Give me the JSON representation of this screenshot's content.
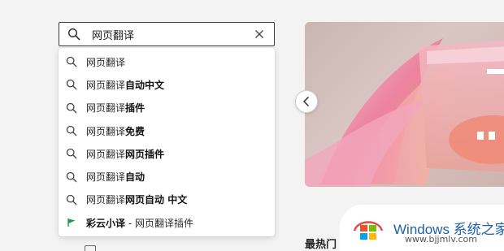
{
  "search": {
    "value": "网页翻译"
  },
  "suggestions": [
    {
      "base": "网页翻译",
      "extra": "",
      "icon": "search-icon"
    },
    {
      "base": "网页翻译",
      "extra": "自动中文",
      "icon": "search-icon"
    },
    {
      "base": "网页翻译",
      "extra": "插件",
      "icon": "search-icon"
    },
    {
      "base": "网页翻译",
      "extra": "免费",
      "icon": "search-icon"
    },
    {
      "base": "网页翻译",
      "extra": "网页插件",
      "icon": "search-icon"
    },
    {
      "base": "网页翻译",
      "extra": "自动",
      "icon": "search-icon"
    },
    {
      "base": "网页翻译",
      "extra": "网页自动 中文",
      "icon": "search-icon"
    }
  ],
  "app_suggestion": {
    "name": "彩云小译",
    "separator": " - ",
    "desc": "网页翻译插件",
    "icon": "caiyun-flag-icon",
    "icon_color": "#1a9b4a"
  },
  "section": {
    "title": "最热门"
  },
  "watermark": {
    "title": "Windows 系统之家",
    "url": "www.bjjmlv.com"
  },
  "colors": {
    "search_border": "#3a3a3a",
    "accent_pink": "#f07a9a",
    "watermark_blue": "#1d5fb0"
  }
}
